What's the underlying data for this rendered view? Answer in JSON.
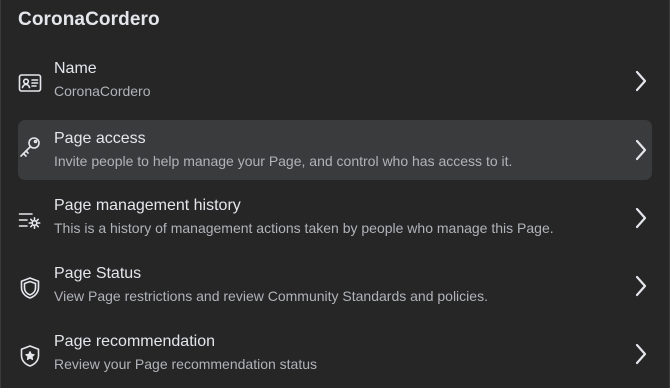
{
  "page": {
    "title": "CoronaCordero"
  },
  "rows": [
    {
      "title": "Name",
      "subtitle": "CoronaCordero",
      "icon": "id-card-icon",
      "active": false
    },
    {
      "title": "Page access",
      "subtitle": "Invite people to help manage your Page, and control who has access to it.",
      "icon": "key-icon",
      "active": true
    },
    {
      "title": "Page management history",
      "subtitle": "This is a history of management actions taken by people who manage this Page.",
      "icon": "list-settings-icon",
      "active": false
    },
    {
      "title": "Page Status",
      "subtitle": "View Page restrictions and review Community Standards and policies.",
      "icon": "shield-icon",
      "active": false
    },
    {
      "title": "Page recommendation",
      "subtitle": "Review your Page recommendation status",
      "icon": "shield-star-icon",
      "active": false
    }
  ],
  "colors": {
    "background": "#262627",
    "active_row": "#3a3b3c",
    "primary_text": "#e4e6eb",
    "secondary_text": "#b0b3b8"
  }
}
